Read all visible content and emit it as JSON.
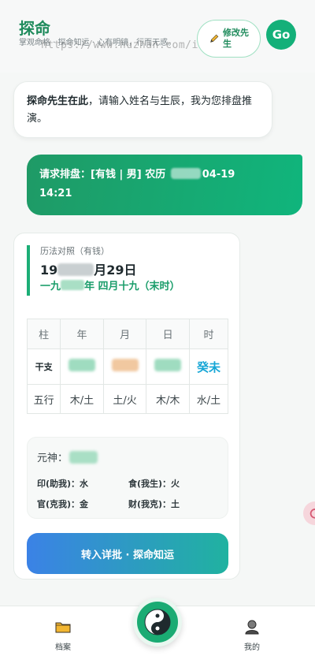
{
  "header": {
    "title": "探命",
    "subtitle": "掌观命格 · 探命知运 · 心有明镜，行而无惑。",
    "watermark": "https://www.huzhan.com/ishop21780",
    "edit_button": "修改先生",
    "go_button": "Go"
  },
  "chat": {
    "bot_name": "探命先生在此",
    "bot_message": "，请输入姓名与生辰，我为您排盘推演。",
    "user_line1_prefix": "请求排盘：[有钱 | 男] 农历 ",
    "user_line1_suffix": "04-19",
    "user_line2": "14:21"
  },
  "result": {
    "calendar_label": "历法对照（有钱）",
    "solar_prefix": "19",
    "solar_suffix": "月29日",
    "lunar_prefix": "一九",
    "lunar_suffix": "年 四月十九（末时）",
    "table": {
      "headers": [
        "柱",
        "年",
        "月",
        "日",
        "时"
      ],
      "ganzhi_label": "干支",
      "hour_ganzhi": "癸未",
      "wuxing_label": "五行",
      "wuxing": [
        "木/土",
        "土/火",
        "木/木",
        "水/土"
      ]
    },
    "yuanshen_label": "元神：",
    "relations": {
      "yin": "印(助我)：水",
      "shi": "食(我生)：火",
      "guan": "官(克我)：金",
      "cai": "财(我克)：土"
    },
    "cta_label": "转入详批 · 探命知运"
  },
  "tabbar": {
    "archive_label": "档案",
    "mine_label": "我的"
  },
  "colors": {
    "brand": "#1f8b5c",
    "accent": "#14b079",
    "hour_pillar": "#16a6d6"
  }
}
